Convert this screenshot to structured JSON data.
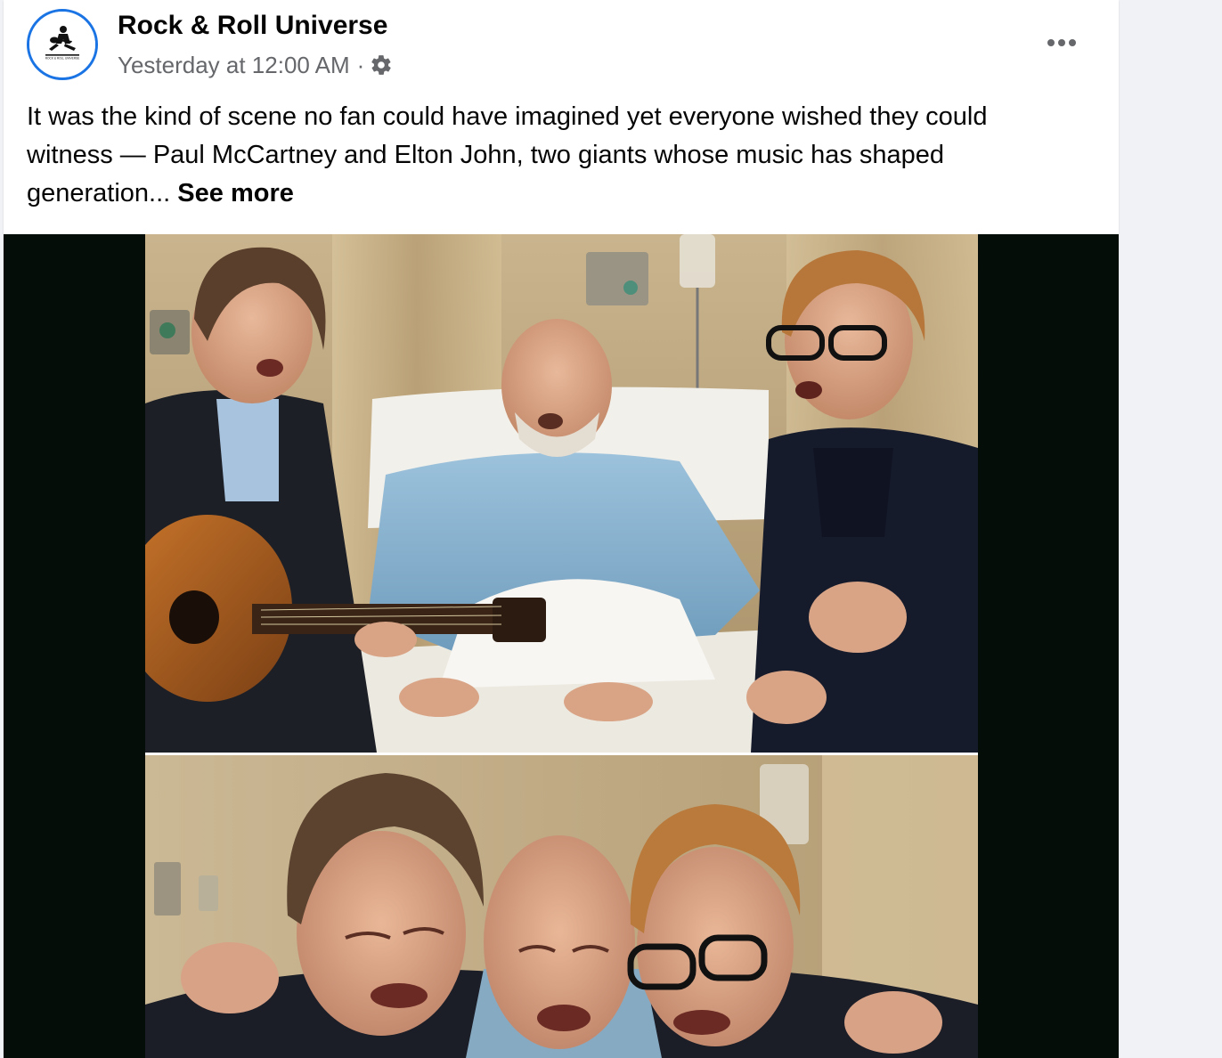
{
  "post": {
    "page_name": "Rock & Roll Universe",
    "timestamp": "Yesterday at 12:00 AM",
    "separator": "·",
    "audience_icon": "gear-icon",
    "more_icon": "more-horizontal-icon",
    "text": "It was the kind of scene no fan could have imagined yet everyone wished they could witness — Paul McCartney and Elton John, two giants whose music has shaped generation...",
    "see_more_label": "See more",
    "avatar_logo_text": "ROCK & ROLL UNIVERSE",
    "avatar_border_color": "#1b74e4"
  },
  "media": {
    "photos": [
      {
        "name": "hospital-singing-photo"
      },
      {
        "name": "hospital-embrace-photo"
      }
    ],
    "background_color": "#050d08"
  },
  "colors": {
    "page_background": "#f0f2f5",
    "card_background": "#ffffff",
    "primary_text": "#050505",
    "secondary_text": "#65676b"
  }
}
